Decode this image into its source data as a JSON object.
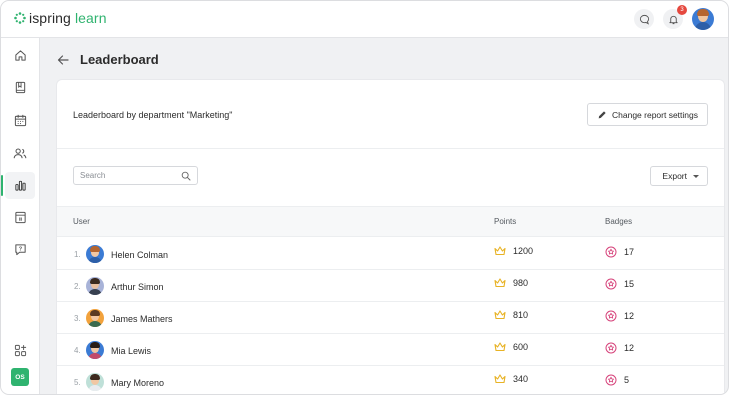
{
  "app": {
    "brand_prefix": "ispring",
    "brand_suffix": "learn"
  },
  "topbar": {
    "notifications_count": "3"
  },
  "sidebar": {
    "items": [
      {
        "icon": "home-icon"
      },
      {
        "icon": "book-icon"
      },
      {
        "icon": "calendar-icon"
      },
      {
        "icon": "users-icon"
      },
      {
        "icon": "bar-chart-icon",
        "active": true
      },
      {
        "icon": "page-icon"
      },
      {
        "icon": "help-chat-icon"
      }
    ],
    "add_widget_icon": "widgets-add-icon",
    "org_badge": "OS"
  },
  "page": {
    "title": "Leaderboard"
  },
  "report": {
    "title": "Leaderboard by department \"Marketing\"",
    "settings_label": "Change report settings"
  },
  "toolbar": {
    "search_placeholder": "Search",
    "export_label": "Export"
  },
  "table": {
    "headers": {
      "user": "User",
      "points": "Points",
      "badges": "Badges"
    },
    "rows": [
      {
        "rank": "1.",
        "name": "Helen Colman",
        "points": "1200",
        "badges": "17"
      },
      {
        "rank": "2.",
        "name": "Arthur Simon",
        "points": "980",
        "badges": "15"
      },
      {
        "rank": "3.",
        "name": "James Mathers",
        "points": "810",
        "badges": "12"
      },
      {
        "rank": "4.",
        "name": "Mia Lewis",
        "points": "600",
        "badges": "12"
      },
      {
        "rank": "5.",
        "name": "Mary Moreno",
        "points": "340",
        "badges": "5"
      }
    ]
  },
  "colors": {
    "accent": "#2fb36f",
    "crown": "#e8b326",
    "badge": "#d6427a",
    "notification": "#e5483e"
  }
}
